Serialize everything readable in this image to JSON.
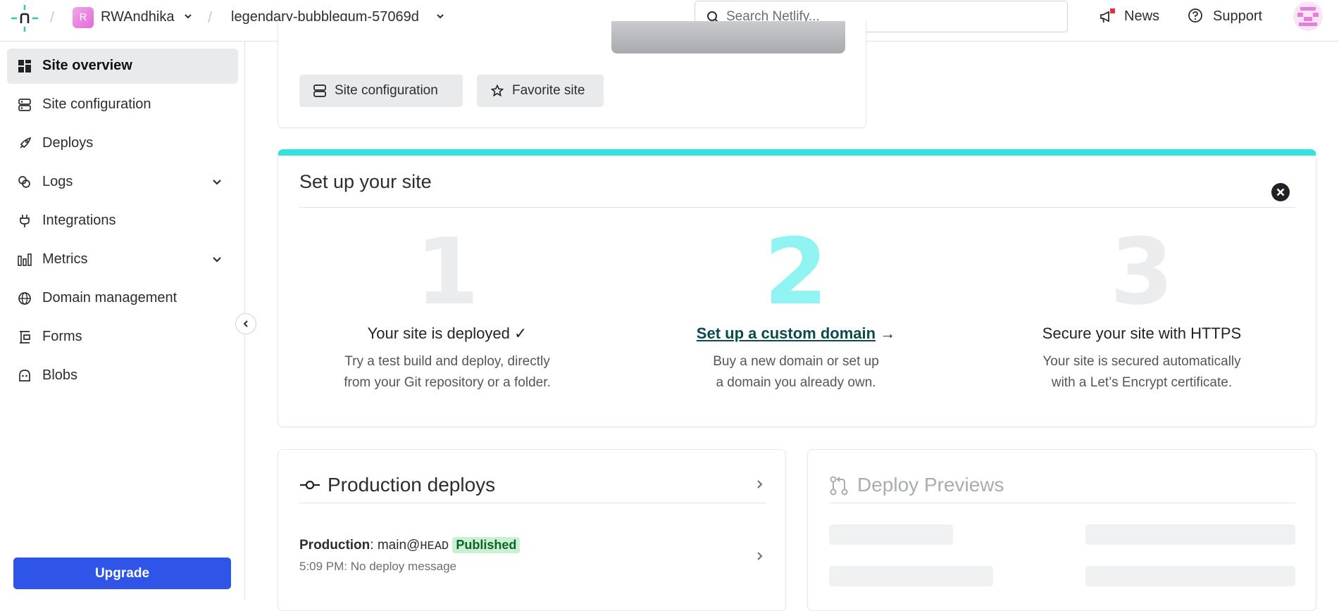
{
  "header": {
    "team_initial": "R",
    "team_name": "RWAndhika",
    "site_name": "legendary-bubblegum-57069d",
    "search_placeholder": "Search Netlify...",
    "news_label": "News",
    "support_label": "Support"
  },
  "sidebar": {
    "items": [
      {
        "label": "Site overview",
        "icon": "grid-icon",
        "active": true
      },
      {
        "label": "Site configuration",
        "icon": "config-icon"
      },
      {
        "label": "Deploys",
        "icon": "rocket-icon"
      },
      {
        "label": "Logs",
        "icon": "logs-icon",
        "expandable": true
      },
      {
        "label": "Integrations",
        "icon": "plug-icon"
      },
      {
        "label": "Metrics",
        "icon": "bar-chart-icon",
        "expandable": true
      },
      {
        "label": "Domain management",
        "icon": "globe-icon"
      },
      {
        "label": "Forms",
        "icon": "form-icon"
      },
      {
        "label": "Blobs",
        "icon": "blob-icon"
      }
    ],
    "upgrade_label": "Upgrade"
  },
  "site_card": {
    "config_button": "Site configuration",
    "favorite_button": "Favorite site"
  },
  "setup": {
    "title": "Set up your site",
    "steps": [
      {
        "number": "1",
        "heading": "Your site is deployed ✓",
        "body_line1": "Try a test build and deploy, directly",
        "body_line2": "from your Git repository or a folder."
      },
      {
        "number": "2",
        "heading": "Set up a custom domain",
        "heading_arrow": "→",
        "body_line1": "Buy a new domain or set up",
        "body_line2": "a domain you already own."
      },
      {
        "number": "3",
        "heading": "Secure your site with HTTPS",
        "body_line1": "Your site is secured automatically",
        "body_line2": "with a Let’s Encrypt certificate."
      }
    ]
  },
  "production": {
    "title": "Production deploys",
    "label": "Production",
    "colon": ":",
    "branch": "main@",
    "ref": "HEAD",
    "status": "Published",
    "subline": "5:09 PM: No deploy message"
  },
  "previews": {
    "title": "Deploy Previews"
  },
  "colors": {
    "accent": "#33e3e0",
    "upgrade": "#2e54e8",
    "published_bg": "#c8f2cf"
  }
}
